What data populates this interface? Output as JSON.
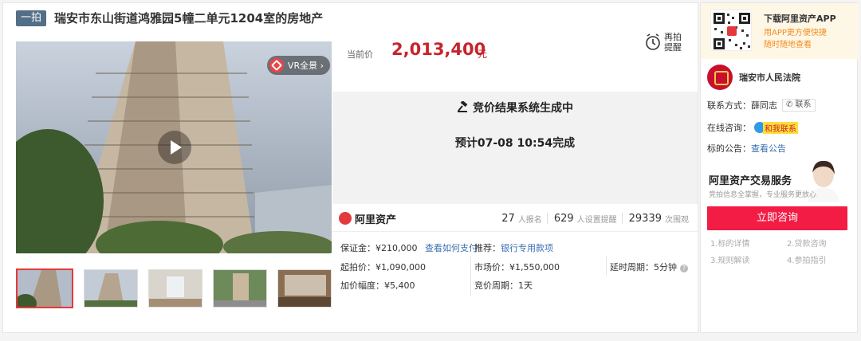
{
  "header": {
    "badge": "一拍",
    "title": "瑞安市东山街道鸿雅园5幢二单元1204室的房地产"
  },
  "photo": {
    "vr_label": "VR全景 ›"
  },
  "price": {
    "label": "当前价",
    "value": "2,013,400",
    "unit": "元"
  },
  "remind": {
    "label": "再拍提醒"
  },
  "status": {
    "line1": "竞价结果系统生成中",
    "line2": "预计07-08 10:54完成"
  },
  "brand": {
    "name": "阿里资产"
  },
  "stats": {
    "signed": "27",
    "signed_label": "人报名",
    "reminders": "629",
    "reminders_label": "人设置提醒",
    "views": "29339",
    "views_label": "次围观"
  },
  "details": {
    "deposit_label": "保证金：",
    "deposit": "¥210,000",
    "deposit_link": "查看如何支付",
    "recommend_label": "推荐：",
    "recommend_link": "银行专用款项",
    "start_label": "起拍价：",
    "start": "¥1,090,000",
    "market_label": "市场价：",
    "market": "¥1,550,000",
    "delay_label": "延时周期：",
    "delay": "5分钟",
    "increment_label": "加价幅度：",
    "increment": "¥5,400",
    "cycle_label": "竞价周期：",
    "cycle": "1天"
  },
  "sidebar": {
    "app_title": "下载阿里资产APP",
    "app_sub1": "用APP更方便快捷",
    "app_sub2": "随时随地查看",
    "court": "瑞安市人民法院",
    "contact_label": "联系方式：",
    "contact_name": "薛同志",
    "contact_button": "✆ 联系",
    "online_label": "在线咨询：",
    "online_button": "和我联系",
    "notice_label": "标的公告：",
    "notice_link": "查看公告",
    "service_title": "阿里资产交易服务",
    "service_sub": "竞拍信息全掌握，专业服务更放心",
    "consult_button": "立即咨询",
    "faq": [
      "1.标的详情",
      "2.贷款咨询",
      "3.规则解读",
      "4.参拍指引"
    ]
  },
  "colors": {
    "accent": "#c8232c",
    "button": "#f21c44",
    "link": "#3a6fb0"
  }
}
